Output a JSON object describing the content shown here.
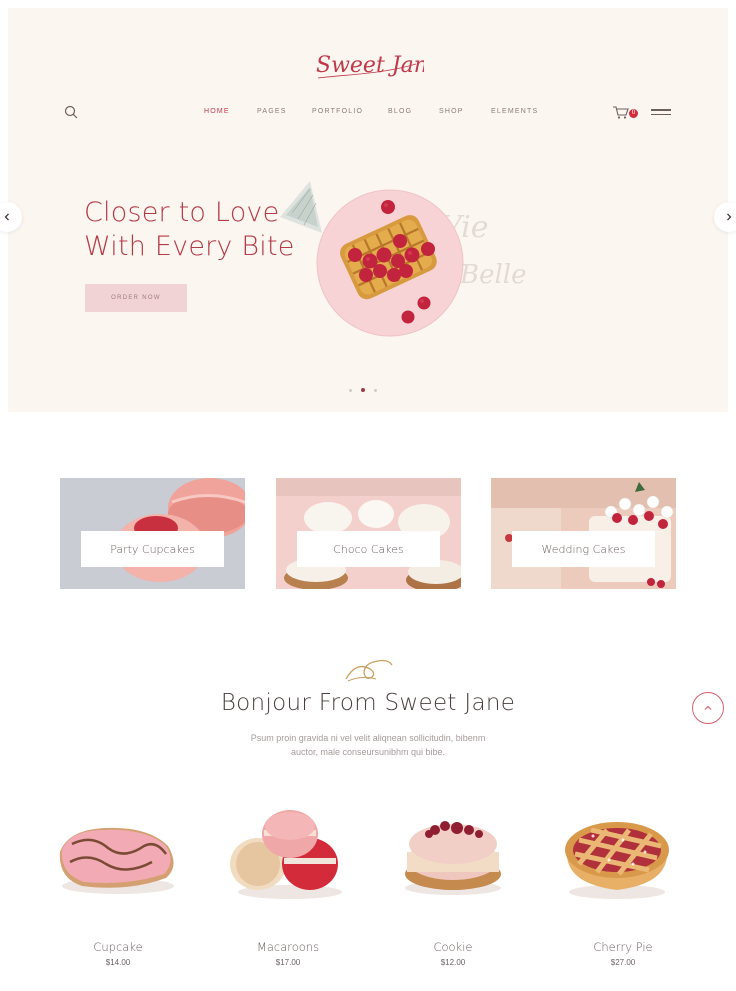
{
  "brand": {
    "logo_text": "Sweet Jane",
    "accent": "#c0394a",
    "hero_bg": "#fcf6f1"
  },
  "header": {
    "nav": [
      {
        "label": "HOME",
        "active": true
      },
      {
        "label": "PAGES",
        "active": false
      },
      {
        "label": "PORTFOLIO",
        "active": false
      },
      {
        "label": "BLOG",
        "active": false
      },
      {
        "label": "SHOP",
        "active": false
      },
      {
        "label": "ELEMENTS",
        "active": false
      }
    ],
    "cart_count": "0",
    "icons": {
      "search": "search-icon",
      "cart": "cart-icon",
      "menu": "hamburger-menu-icon"
    }
  },
  "hero": {
    "title_line1": "Closer to Love",
    "title_line2": "With Every Bite",
    "button_label": "ORDER NOW",
    "script_text_1": "Vie",
    "script_text_2": "Belle",
    "slides": 3,
    "active_slide": 2
  },
  "categories": [
    {
      "label": "Party Cupcakes"
    },
    {
      "label": "Choco Cakes"
    },
    {
      "label": "Wedding Cakes"
    }
  ],
  "intro": {
    "title": "Bonjour From Sweet Jane",
    "description_line1": "Psum proin gravida ni vel velit aliqnean sollicitudin, bibenm",
    "description_line2": "auctor, male conseursunibhm qui bibe."
  },
  "products": [
    {
      "name": "Cupcake",
      "price": "$14.00"
    },
    {
      "name": "Macaroons",
      "price": "$17.00"
    },
    {
      "name": "Cookie",
      "price": "$12.00"
    },
    {
      "name": "Cherry Pie",
      "price": "$27.00"
    }
  ]
}
